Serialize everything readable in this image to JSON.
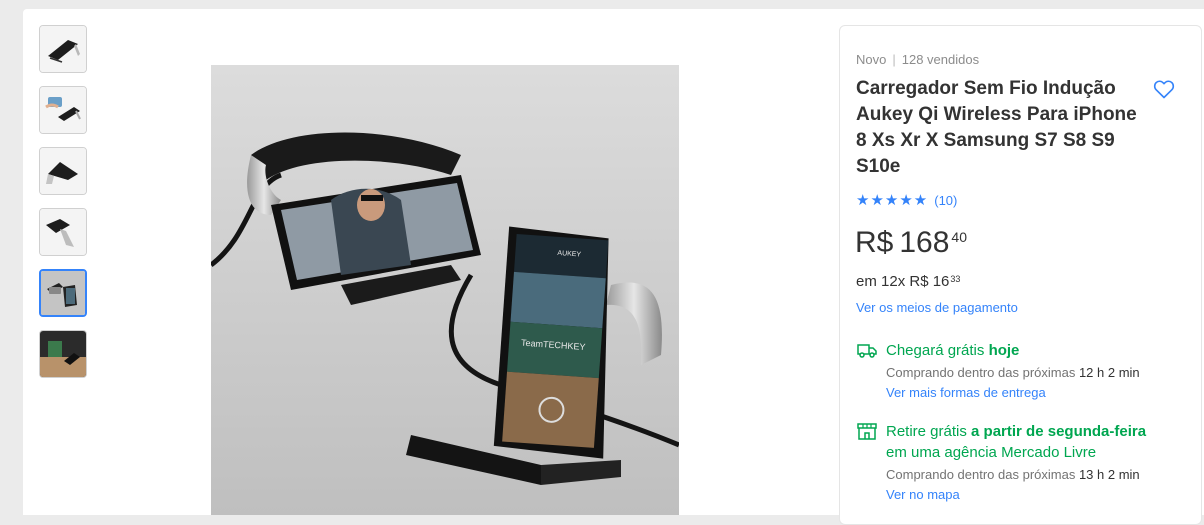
{
  "product": {
    "condition": "Novo",
    "sold": "128 vendidos",
    "title": "Carregador Sem Fio Indução Aukey Qi Wireless Para iPhone 8 Xs Xr X Samsung S7 S8 S9 S10e",
    "rating_stars": "★★★★★",
    "rating_count": "(10)",
    "price_currency": "R$",
    "price_int": "168",
    "price_cents": "40",
    "installment_prefix": "em 12x R$ 16",
    "installment_cents": "33",
    "payment_link": "Ver os meios de pagamento"
  },
  "shipping": {
    "delivery": {
      "headline_prefix": "Chegará grátis ",
      "headline_strong": "hoje",
      "sub_prefix": "Comprando dentro das próximas ",
      "sub_time": "12 h 2 min",
      "link": "Ver mais formas de entrega"
    },
    "pickup": {
      "headline_prefix": "Retire grátis ",
      "headline_strong": "a partir de segunda-feira",
      "headline_line2": "em uma agência Mercado Livre",
      "sub_prefix": "Comprando dentro das próximas ",
      "sub_time": "13 h 2 min",
      "link": "Ver no mapa"
    }
  },
  "gallery": {
    "thumbnails": [
      {
        "icon": "stand-black-thumb"
      },
      {
        "icon": "phone-hand-thumb"
      },
      {
        "icon": "stand-silver-thumb"
      },
      {
        "icon": "stand-side-thumb"
      },
      {
        "icon": "two-phones-thumb",
        "active": true
      },
      {
        "icon": "desk-scene-thumb"
      }
    ],
    "main_image": "two-phones-on-chargers",
    "main_image_text": "AUKEY",
    "screen_text": "TeamTECHKEY"
  },
  "colors": {
    "accent": "#3483fa",
    "green": "#00a650",
    "background": "#ebebeb"
  }
}
